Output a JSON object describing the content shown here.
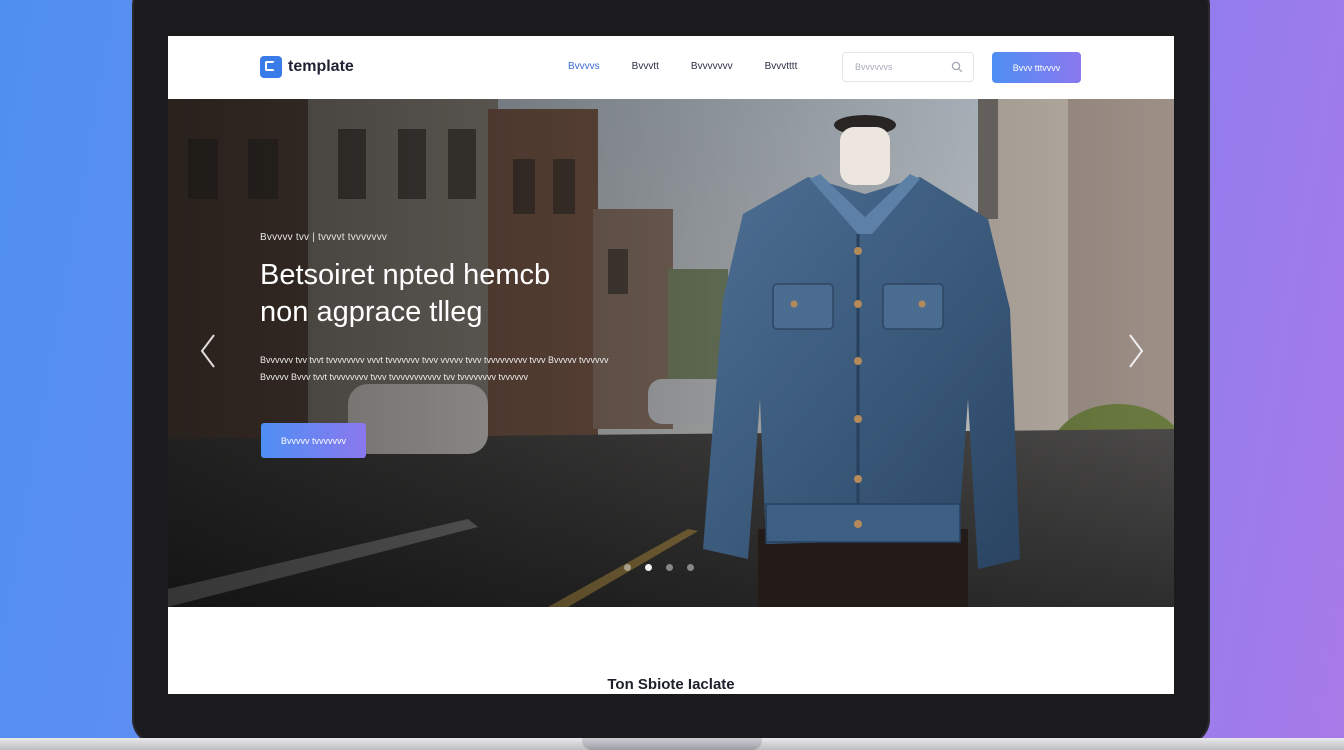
{
  "nav": {
    "logo_text": "template",
    "links": [
      "Bvvvvs",
      "Bvvvtt",
      "Bvvvvvvv",
      "Bvvvtttt"
    ],
    "search_placeholder": "Bvvvvvvs",
    "cta_label": "Bvvv tttvvvv"
  },
  "hero": {
    "eyebrow": "Bvvvvv tvv | tvvvvt tvvvvvvv",
    "title_line1": "Betsoiret npted hemcb",
    "title_line2": "non agprace tlleg",
    "description": "Bvvvvvv tvv tvvt tvvvvvvvv vvvt tvvvvvvv tvvv vvvvv tvvv tvvvvvvvvv tvvv Bvvvvv tvvvvvv Bvvvvv Bvvv tvvt tvvvvvvvv tvvv tvvvvvvvvvvv tvv tvvvvvvvv tvvvvvv",
    "cta_label": "Bvvvvv tvvvvvvv",
    "slide_count": 4,
    "active_slide": 2
  },
  "section": {
    "title": "Ton Sbiote Iaclate"
  },
  "colors": {
    "accent_start": "#4e8ff4",
    "accent_end": "#8b78ee",
    "brand": "#3a7bea"
  }
}
